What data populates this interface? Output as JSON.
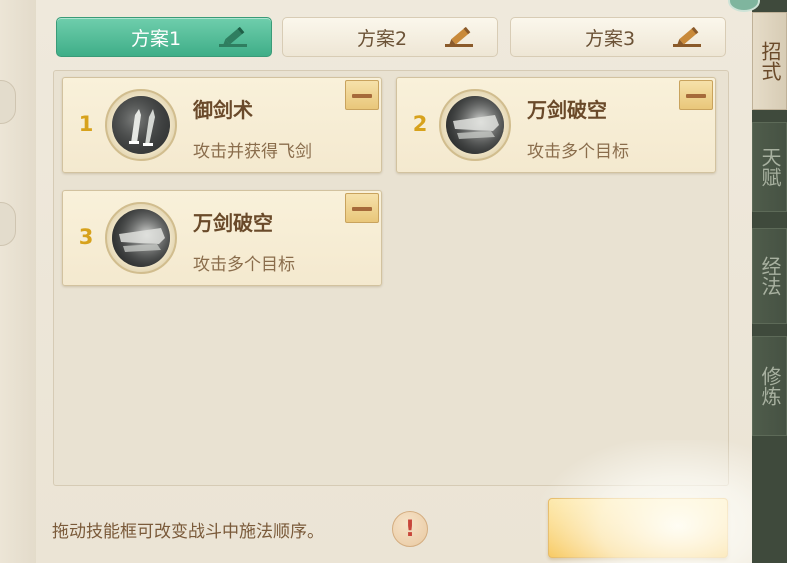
{
  "tabs": [
    {
      "label": "方案1",
      "active": true
    },
    {
      "label": "方案2",
      "active": false
    },
    {
      "label": "方案3",
      "active": false
    }
  ],
  "skills": [
    {
      "order": "1",
      "name": "御剑术",
      "desc": "攻击并获得飞剑",
      "icon": "flying-swords-icon"
    },
    {
      "order": "2",
      "name": "万剑破空",
      "desc": "攻击多个目标",
      "icon": "sword-storm-icon"
    },
    {
      "order": "3",
      "name": "万剑破空",
      "desc": "攻击多个目标",
      "icon": "sword-storm-icon"
    }
  ],
  "hint": {
    "text": "拖动技能框可改变战斗中施法顺序。",
    "icon_glyph": "!"
  },
  "side_tabs": [
    {
      "label": "招式",
      "active": true
    },
    {
      "label": "天赋",
      "active": false
    },
    {
      "label": "经法",
      "active": false
    },
    {
      "label": "修炼",
      "active": false
    }
  ],
  "colors": {
    "active_tab": "#4fbd96",
    "card_bg": "#f7eed6",
    "accent_number": "#d7a21c",
    "confirm_button": "#f7c658"
  }
}
